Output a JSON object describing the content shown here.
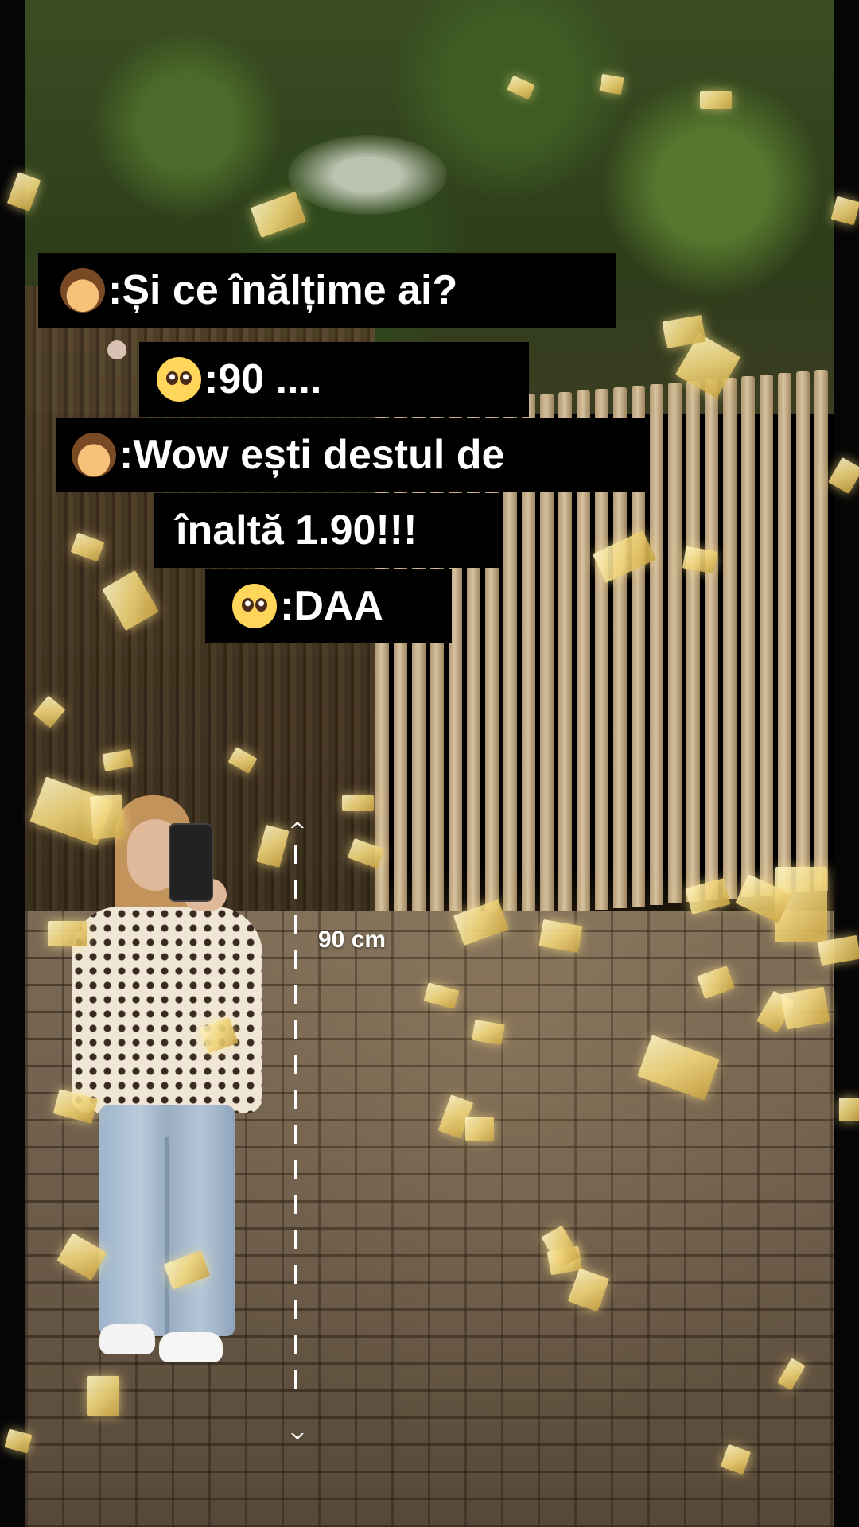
{
  "captions": {
    "line1": ":Și ce înălțime ai?",
    "line2": ":90 ....",
    "line3": ":Wow ești destul de",
    "line4": "înaltă 1.90!!!",
    "line5": ":DAA"
  },
  "emoji": {
    "speaker_boy": "boy-emoji",
    "speaker_girl": "pleading-face-emoji"
  },
  "measurement": {
    "label": "90 cm",
    "up_arrow": "^",
    "down_arrow": "^"
  },
  "colors": {
    "caption_bg": "#000000",
    "caption_text": "#ffffff",
    "confetti": "#f2d57a"
  }
}
